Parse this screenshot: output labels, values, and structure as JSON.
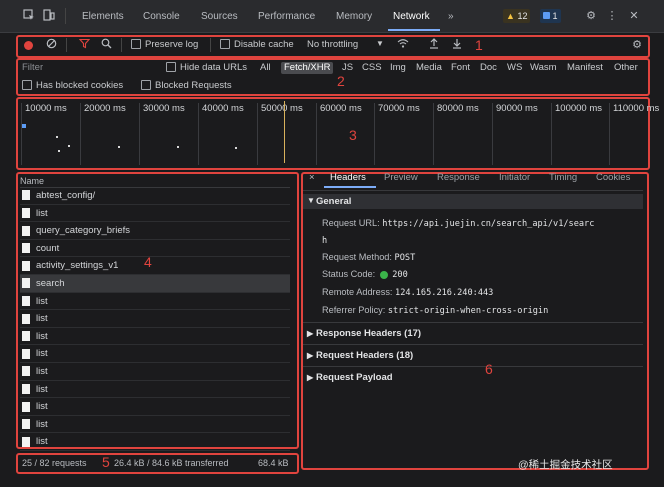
{
  "tabs": [
    "Elements",
    "Console",
    "Sources",
    "Performance",
    "Memory",
    "Network"
  ],
  "more_tabs": "»",
  "warnings_count": "12",
  "info_count": "1",
  "toolbar": {
    "preserve_log": "Preserve log",
    "disable_cache": "Disable cache",
    "throttle": "No throttling"
  },
  "filter": {
    "placeholder": "Filter",
    "hide_data_urls": "Hide data URLs",
    "types": [
      "All",
      "Fetch/XHR",
      "JS",
      "CSS",
      "Img",
      "Media",
      "Font",
      "Doc",
      "WS",
      "Wasm",
      "Manifest",
      "Other"
    ],
    "selected_type": "Fetch/XHR",
    "blocked_cookies": "Has blocked cookies",
    "blocked_requests": "Blocked Requests"
  },
  "timeline": {
    "ticks": [
      "10000 ms",
      "20000 ms",
      "30000 ms",
      "40000 ms",
      "50000 ms",
      "60000 ms",
      "70000 ms",
      "80000 ms",
      "90000 ms",
      "100000 ms",
      "110000 ms"
    ]
  },
  "requests": {
    "header": "Name",
    "items": [
      "abtest_config/",
      "list",
      "query_category_briefs",
      "count",
      "activity_settings_v1",
      "search",
      "list",
      "list",
      "list",
      "list",
      "list",
      "list",
      "list",
      "list",
      "list"
    ],
    "selected": "search"
  },
  "details": {
    "close": "×",
    "tabs": [
      "Headers",
      "Preview",
      "Response",
      "Initiator",
      "Timing",
      "Cookies"
    ],
    "general_title": "General",
    "request_url_label": "Request URL:",
    "request_url_1": "https://api.juejin.cn/search_api/v1/searc",
    "request_url_2": "h",
    "method_label": "Request Method:",
    "method": "POST",
    "status_label": "Status Code:",
    "status": "200",
    "remote_label": "Remote Address:",
    "remote": "124.165.216.240:443",
    "referrer_label": "Referrer Policy:",
    "referrer": "strict-origin-when-cross-origin",
    "response_headers": "Response Headers (17)",
    "request_headers": "Request Headers (18)",
    "request_payload": "Request Payload"
  },
  "status_bar": {
    "requests": "25 / 82 requests",
    "transferred": "26.4 kB / 84.6 kB transferred",
    "resources": "68.4 kB"
  },
  "annotations": [
    "1",
    "2",
    "3",
    "4",
    "5",
    "6"
  ],
  "watermark": "@稀土掘金技术社区",
  "colors": {
    "annotation_red": "#e0443e",
    "record_red": "#e0443e",
    "status_green": "#3bb34a",
    "accent_blue": "#7cacf8"
  }
}
